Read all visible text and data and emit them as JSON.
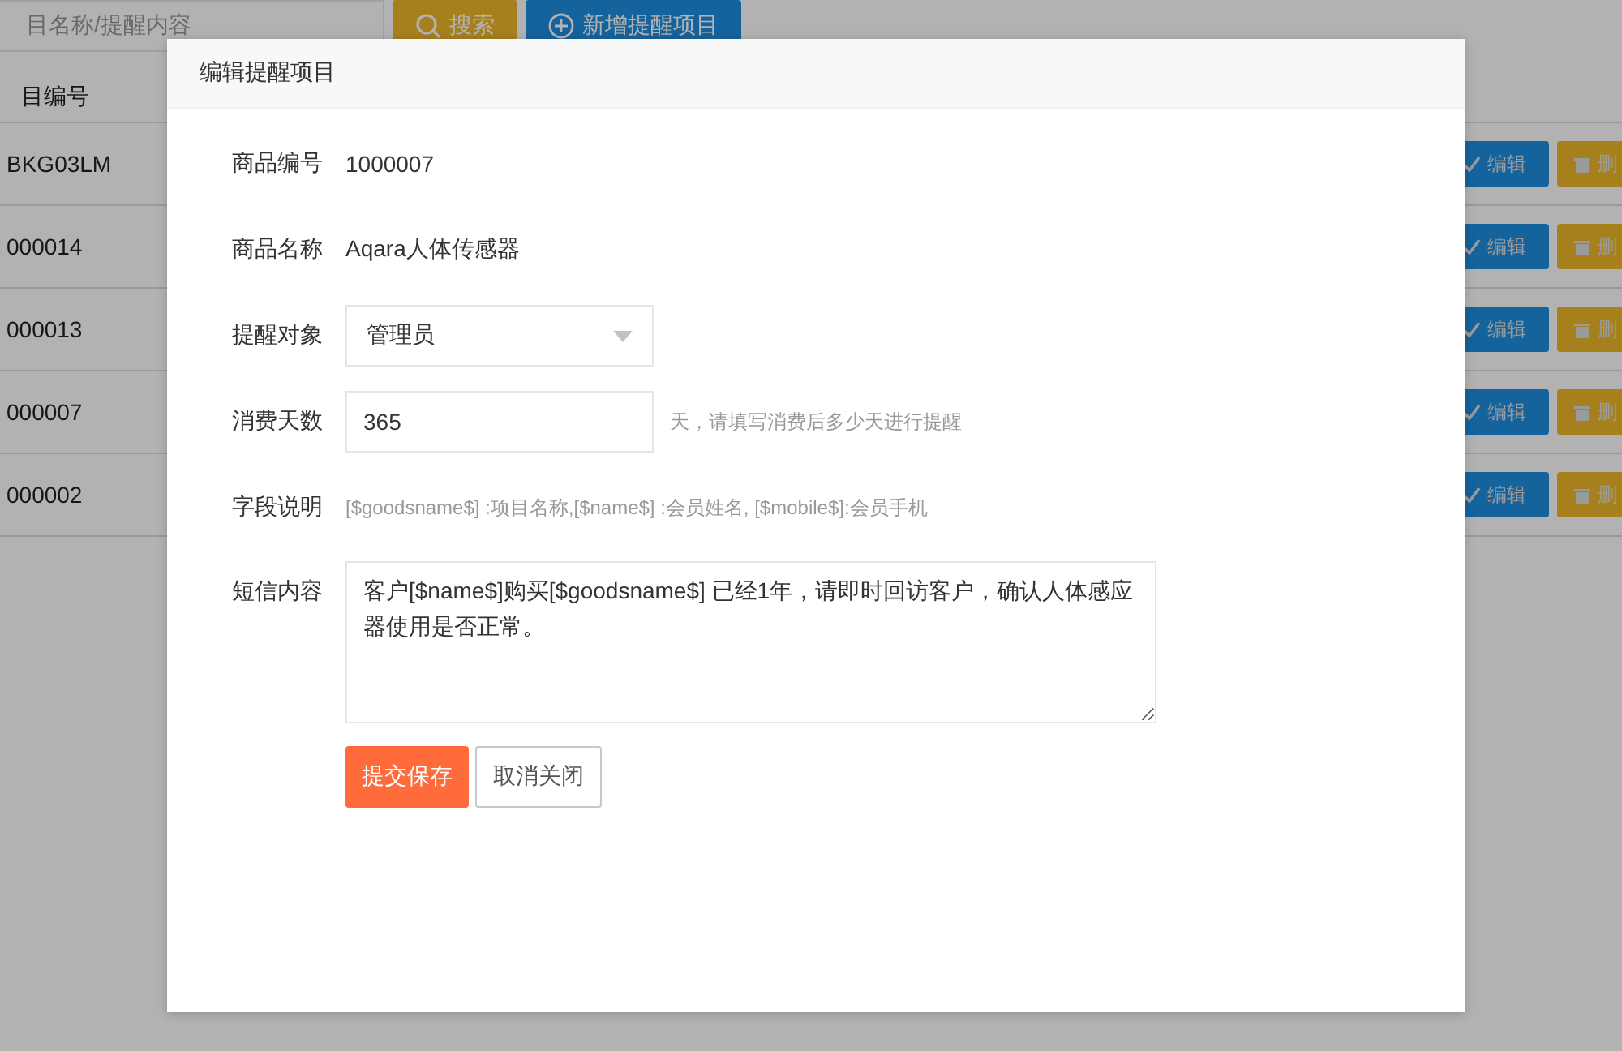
{
  "toolbar": {
    "search": {
      "placeholder": "目名称/提醒内容"
    },
    "buttons": [
      {
        "label": "搜索",
        "kind": "search"
      },
      {
        "label": "新增提醒项目",
        "kind": "add"
      }
    ]
  },
  "table": {
    "columns": [
      "目编号"
    ],
    "rows": [
      {
        "cells": [
          "BKG03LM"
        ],
        "actions": [
          "编辑",
          "删"
        ]
      },
      {
        "cells": [
          "000014"
        ],
        "actions": [
          "编辑",
          "删"
        ]
      },
      {
        "cells": [
          "000013"
        ],
        "actions": [
          "编辑",
          "删"
        ]
      },
      {
        "cells": [
          "000007"
        ],
        "actions": [
          "编辑",
          "删"
        ]
      },
      {
        "cells": [
          "000002"
        ],
        "actions": [
          "编辑",
          "删"
        ]
      }
    ]
  },
  "dialog": {
    "title": "编辑提醒项目",
    "fields": [
      {
        "kind": "text",
        "label": "商品编号",
        "value": "1000007"
      },
      {
        "kind": "text",
        "label": "商品名称",
        "value": "Aqara人体传感器"
      },
      {
        "kind": "select",
        "label": "提醒对象",
        "value": "管理员"
      },
      {
        "kind": "input",
        "label": "消费天数",
        "value": "365",
        "hint": "天，请填写消费后多少天进行提醒"
      },
      {
        "kind": "note",
        "label": "字段说明",
        "value": "[$goodsname$] :项目名称,[$name$] :会员姓名, [$mobile$]:会员手机"
      },
      {
        "kind": "textarea",
        "label": "短信内容",
        "value": "客户[$name$]购买[$goodsname$] 已经1年，请即时回访客户，确认人体感应器使用是否正常。"
      }
    ],
    "buttons": [
      {
        "label": "提交保存",
        "kind": "primary"
      },
      {
        "label": "取消关闭",
        "kind": "secondary"
      }
    ]
  }
}
